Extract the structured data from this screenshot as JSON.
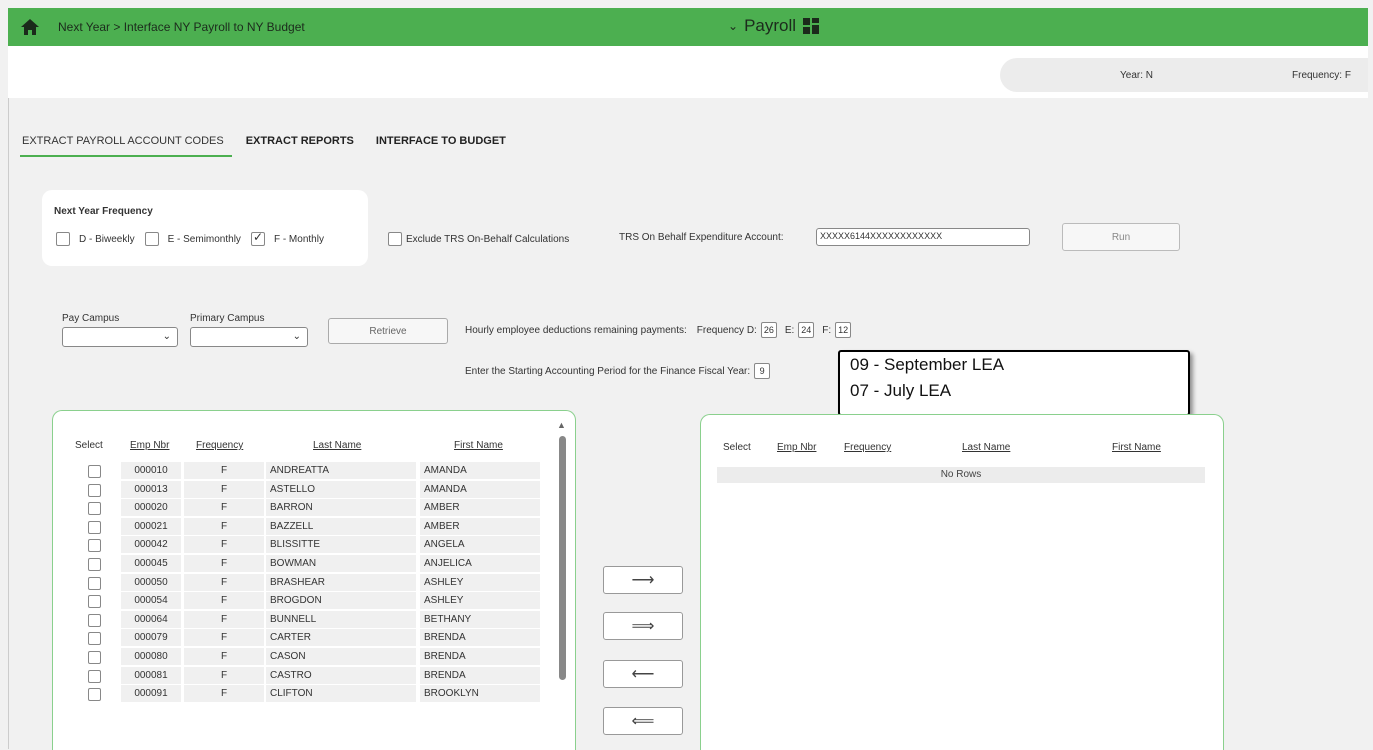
{
  "header": {
    "breadcrumb": "Next Year > Interface NY Payroll to NY Budget",
    "module": "Payroll"
  },
  "status": {
    "year_label": "Year:",
    "year_value": "N",
    "freq_label": "Frequency:",
    "freq_value": "F"
  },
  "tabs": [
    {
      "label": "EXTRACT PAYROLL ACCOUNT CODES"
    },
    {
      "label": "EXTRACT REPORTS"
    },
    {
      "label": "INTERFACE TO BUDGET"
    }
  ],
  "frequency": {
    "title": "Next Year Frequency",
    "options": [
      {
        "label": "D - Biweekly",
        "checked": false
      },
      {
        "label": "E - Semimonthly",
        "checked": false
      },
      {
        "label": "F - Monthly",
        "checked": true
      }
    ]
  },
  "exclude_trs": {
    "label": "Exclude TRS On-Behalf Calculations",
    "checked": false
  },
  "trs_account": {
    "label": "TRS On Behalf Expenditure Account:",
    "value": "XXXXX6144XXXXXXXXXXXX"
  },
  "run_label": "Run",
  "pay_campus_label": "Pay Campus",
  "primary_campus_label": "Primary Campus",
  "retrieve_label": "Retrieve",
  "hourly": {
    "label": "Hourly employee deductions remaining payments:",
    "freq_d_label": "Frequency D:",
    "freq_d": "26",
    "freq_e_label": "E:",
    "freq_e": "24",
    "freq_f_label": "F:",
    "freq_f": "12"
  },
  "period": {
    "label": "Enter the Starting Accounting Period for the Finance Fiscal Year:",
    "value": "9"
  },
  "callout": {
    "line1": "09 - September LEA",
    "line2": "07 - July LEA"
  },
  "columns": {
    "select": "Select",
    "emp_nbr": "Emp Nbr",
    "frequency": "Frequency",
    "last_name": "Last Name",
    "first_name": "First Name"
  },
  "employees": [
    {
      "emp": "000010",
      "freq": "F",
      "last": "ANDREATTA",
      "first": "AMANDA"
    },
    {
      "emp": "000013",
      "freq": "F",
      "last": "ASTELLO",
      "first": "AMANDA"
    },
    {
      "emp": "000020",
      "freq": "F",
      "last": "BARRON",
      "first": "AMBER"
    },
    {
      "emp": "000021",
      "freq": "F",
      "last": "BAZZELL",
      "first": "AMBER"
    },
    {
      "emp": "000042",
      "freq": "F",
      "last": "BLISSITTE",
      "first": "ANGELA"
    },
    {
      "emp": "000045",
      "freq": "F",
      "last": "BOWMAN",
      "first": "ANJELICA"
    },
    {
      "emp": "000050",
      "freq": "F",
      "last": "BRASHEAR",
      "first": "ASHLEY"
    },
    {
      "emp": "000054",
      "freq": "F",
      "last": "BROGDON",
      "first": "ASHLEY"
    },
    {
      "emp": "000064",
      "freq": "F",
      "last": "BUNNELL",
      "first": "BETHANY"
    },
    {
      "emp": "000079",
      "freq": "F",
      "last": "CARTER",
      "first": "BRENDA"
    },
    {
      "emp": "000080",
      "freq": "F",
      "last": "CASON",
      "first": "BRENDA"
    },
    {
      "emp": "000081",
      "freq": "F",
      "last": "CASTRO",
      "first": "BRENDA"
    },
    {
      "emp": "000091",
      "freq": "F",
      "last": "CLIFTON",
      "first": "BROOKLYN"
    }
  ],
  "no_rows": "No Rows",
  "colors": {
    "header_green": "#4caf50",
    "panel_border": "#8ad08d"
  }
}
